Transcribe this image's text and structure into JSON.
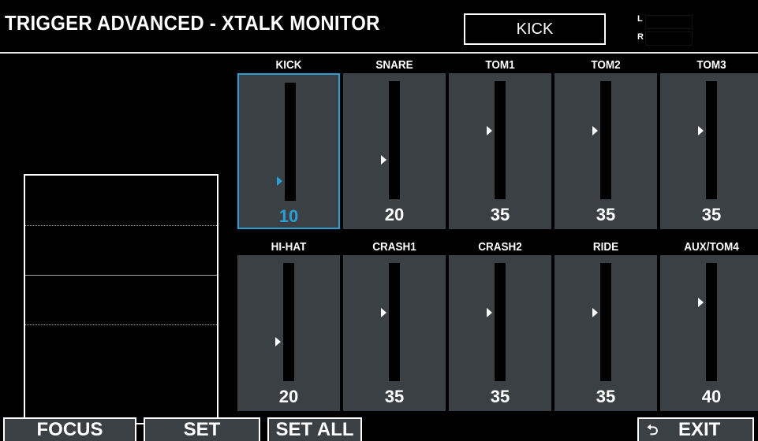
{
  "header": {
    "title": "TRIGGER ADVANCED - XTALK MONITOR",
    "selected_pad": "KICK",
    "meter_l_label": "L",
    "meter_r_label": "R"
  },
  "accent_color": "#2a9fd6",
  "pads_row1": [
    {
      "name": "KICK",
      "value": "10",
      "selected": true
    },
    {
      "name": "SNARE",
      "value": "20",
      "selected": false
    },
    {
      "name": "TOM1",
      "value": "35",
      "selected": false
    },
    {
      "name": "TOM2",
      "value": "35",
      "selected": false
    },
    {
      "name": "TOM3",
      "value": "35",
      "selected": false
    }
  ],
  "pads_row2": [
    {
      "name": "HI-HAT",
      "value": "20",
      "selected": false
    },
    {
      "name": "CRASH1",
      "value": "35",
      "selected": false
    },
    {
      "name": "CRASH2",
      "value": "35",
      "selected": false
    },
    {
      "name": "RIDE",
      "value": "35",
      "selected": false
    },
    {
      "name": "AUX/TOM4",
      "value": "40",
      "selected": false
    }
  ],
  "footer": {
    "focus_label": "FOCUS",
    "set_label": "SET",
    "set_all_label": "SET ALL",
    "exit_icon": "return-arrow-icon",
    "exit_label": "EXIT"
  }
}
